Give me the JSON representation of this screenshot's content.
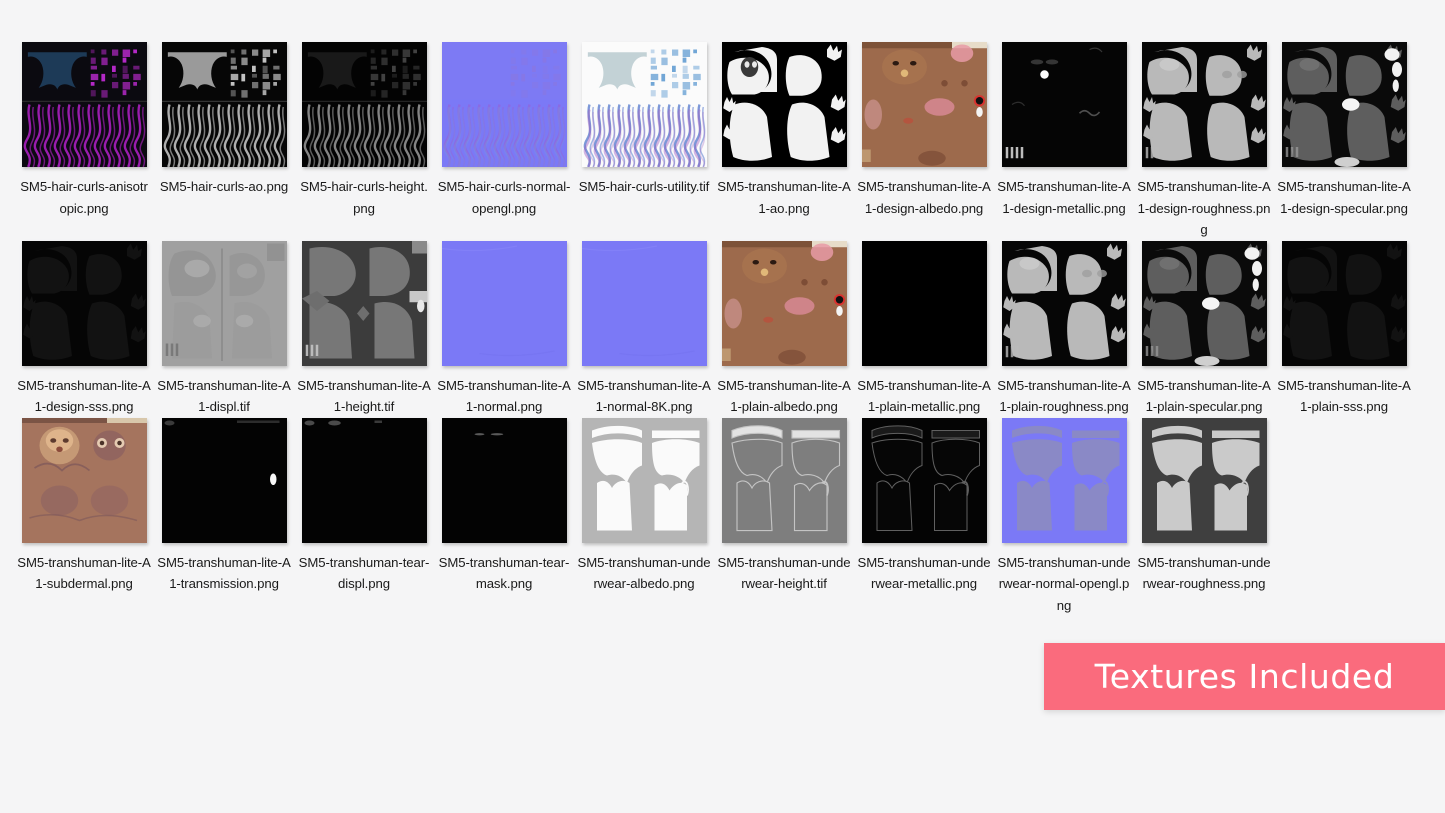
{
  "view": {
    "background_color": "#f5f5f6",
    "layout": "icon-grid",
    "columns": 10,
    "rows": 3,
    "item_count": 30
  },
  "banner": {
    "text": "Textures Included",
    "background_color": "#fa6b7d",
    "text_color": "#ffffff"
  },
  "files": [
    {
      "name": "SM5-hair-curls-anisotropic.png",
      "art": "hair-aniso"
    },
    {
      "name": "SM5-hair-curls-ao.png",
      "art": "hair-gray"
    },
    {
      "name": "SM5-hair-curls-height.png",
      "art": "hair-dark"
    },
    {
      "name": "SM5-hair-curls-normal-opengl.png",
      "art": "hair-normal"
    },
    {
      "name": "SM5-hair-curls-utility.tif",
      "art": "hair-utility"
    },
    {
      "name": "SM5-transhuman-lite-A1-ao.png",
      "art": "body-ao"
    },
    {
      "name": "SM5-transhuman-lite-A1-design-albedo.png",
      "art": "body-albedo"
    },
    {
      "name": "SM5-transhuman-lite-A1-design-metallic.png",
      "art": "body-black-spots"
    },
    {
      "name": "SM5-transhuman-lite-A1-design-roughness.png",
      "art": "body-rough-light"
    },
    {
      "name": "SM5-transhuman-lite-A1-design-specular.png",
      "art": "body-spec-dark"
    },
    {
      "name": "SM5-transhuman-lite-A1-design-sss.png",
      "art": "body-near-black"
    },
    {
      "name": "SM5-transhuman-lite-A1-displ.tif",
      "art": "body-displ"
    },
    {
      "name": "SM5-transhuman-lite-A1-height.tif",
      "art": "body-height"
    },
    {
      "name": "SM5-transhuman-lite-A1-normal.png",
      "art": "flat-normal"
    },
    {
      "name": "SM5-transhuman-lite-A1-normal-8K.png",
      "art": "flat-normal"
    },
    {
      "name": "SM5-transhuman-lite-A1-plain-albedo.png",
      "art": "body-albedo"
    },
    {
      "name": "SM5-transhuman-lite-A1-plain-metallic.png",
      "art": "pure-black"
    },
    {
      "name": "SM5-transhuman-lite-A1-plain-roughness.png",
      "art": "body-rough-light"
    },
    {
      "name": "SM5-transhuman-lite-A1-plain-specular.png",
      "art": "body-spec-dark"
    },
    {
      "name": "SM5-transhuman-lite-A1-plain-sss.png",
      "art": "body-near-black"
    },
    {
      "name": "SM5-transhuman-lite-A1-subdermal.png",
      "art": "subdermal"
    },
    {
      "name": "SM5-transhuman-lite-A1-transmission.png",
      "art": "black-dot"
    },
    {
      "name": "SM5-transhuman-tear-displ.png",
      "art": "black-top-marks"
    },
    {
      "name": "SM5-transhuman-tear-mask.png",
      "art": "black-tear-mask"
    },
    {
      "name": "SM5-transhuman-underwear-albedo.png",
      "art": "underwear-albedo"
    },
    {
      "name": "SM5-transhuman-underwear-height.tif",
      "art": "underwear-height"
    },
    {
      "name": "SM5-transhuman-underwear-metallic.png",
      "art": "underwear-metallic"
    },
    {
      "name": "SM5-transhuman-underwear-normal-opengl.png",
      "art": "underwear-normal"
    },
    {
      "name": "SM5-transhuman-underwear-roughness.png",
      "art": "underwear-roughness"
    }
  ]
}
